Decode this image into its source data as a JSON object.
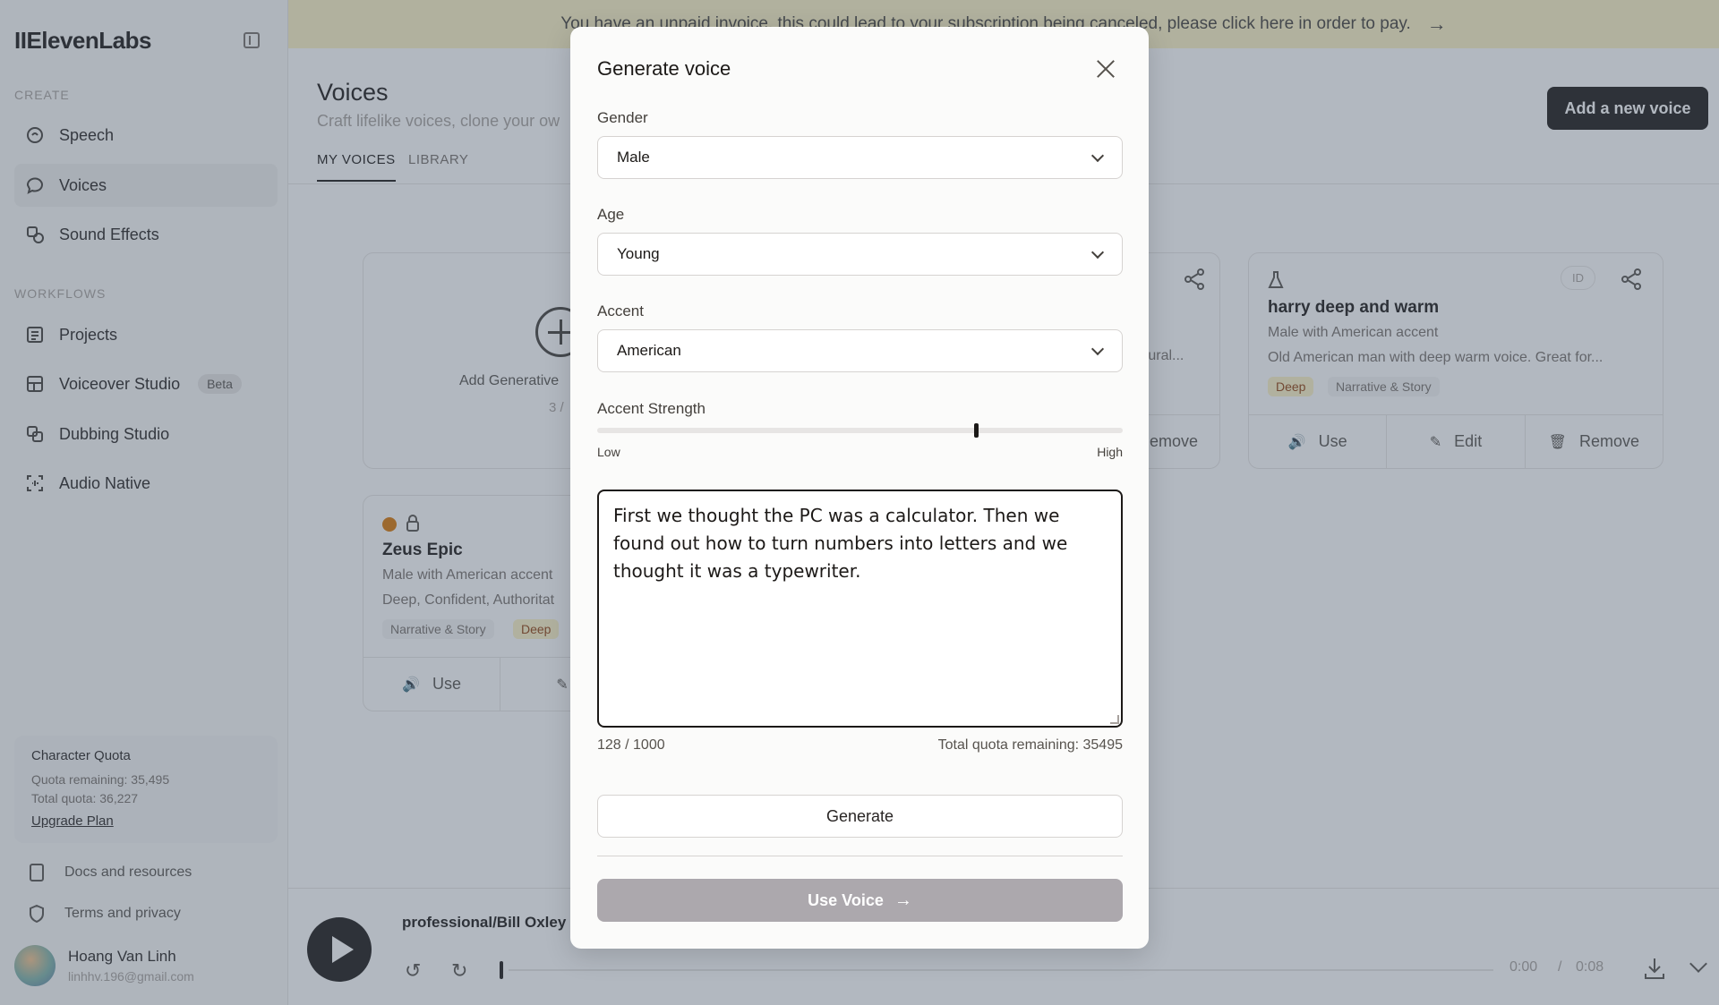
{
  "banner": {
    "text": "You have an unpaid invoice, this could lead to your subscription being canceled, please click here in order to pay.",
    "arrow": "→"
  },
  "sidebar": {
    "logo": "IIElevenLabs",
    "create_label": "CREATE",
    "workflows_label": "WORKFLOWS",
    "create_items": [
      {
        "label": "Speech",
        "icon": "speech-icon"
      },
      {
        "label": "Voices",
        "icon": "voices-icon"
      },
      {
        "label": "Sound Effects",
        "icon": "sound-effects-icon"
      }
    ],
    "workflow_items": [
      {
        "label": "Projects",
        "icon": "projects-icon"
      },
      {
        "label": "Voiceover Studio",
        "icon": "voiceover-icon",
        "badge": "Beta"
      },
      {
        "label": "Dubbing Studio",
        "icon": "dubbing-icon"
      },
      {
        "label": "Audio Native",
        "icon": "audio-native-icon"
      }
    ],
    "quota": {
      "title": "Character Quota",
      "remaining": "Quota remaining: 35,495",
      "total": "Total quota: 36,227",
      "upgrade": "Upgrade Plan"
    },
    "docs": "Docs and resources",
    "terms": "Terms and privacy",
    "user": {
      "name": "Hoang Van Linh",
      "email": "linhhv.196@gmail.com"
    }
  },
  "main": {
    "title": "Voices",
    "subtitle": "Craft lifelike voices, clone your ow",
    "add_button": "Add a new voice",
    "tabs": [
      "MY VOICES",
      "LIBRARY"
    ],
    "add_card": {
      "label": "Add Generative",
      "count": "3 /"
    },
    "card_partial": {
      "line": "atural...",
      "remove": "emove"
    },
    "card_harry": {
      "title": "harry deep and warm",
      "line1": "Male with American accent",
      "line2": "Old American man with deep warm voice. Great for...",
      "tags": [
        "Deep",
        "Narrative & Story"
      ],
      "id_badge": "ID",
      "use": "Use",
      "edit": "Edit",
      "remove": "Remove"
    },
    "card_zeus": {
      "title": "Zeus Epic",
      "line1": "Male with American accent",
      "line2": "Deep, Confident, Authoritat",
      "tags": [
        "Narrative & Story",
        "Deep"
      ],
      "use": "Use"
    }
  },
  "player": {
    "title": "professional/Bill Oxley",
    "current": "0:00",
    "separator": "/",
    "duration": "0:08"
  },
  "modal": {
    "title": "Generate voice",
    "gender_label": "Gender",
    "gender_value": "Male",
    "age_label": "Age",
    "age_value": "Young",
    "accent_label": "Accent",
    "accent_value": "American",
    "strength_label": "Accent Strength",
    "strength_low": "Low",
    "strength_high": "High",
    "accent_strength": 0.72,
    "text": "First we thought the PC was a calculator. Then we found out how to turn numbers into letters and we thought it was a typewriter.",
    "char_count": "128 / 1000",
    "quota_remaining": "Total quota remaining: 35495",
    "generate": "Generate",
    "use_voice": "Use Voice",
    "use_voice_arrow": "→"
  }
}
